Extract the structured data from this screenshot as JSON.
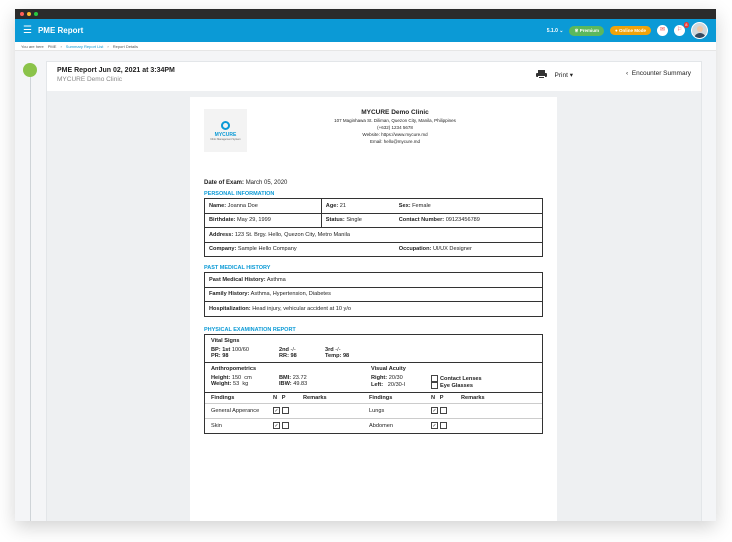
{
  "window": {
    "dots": [
      "#ff5f57",
      "#febc2e",
      "#28c840"
    ]
  },
  "appbar": {
    "title": "PME Report",
    "version": "5.1.0",
    "premium_label": "Premium",
    "online_label": "Online Mode",
    "notif_count_1": "",
    "notif_count_2": "8",
    "accent": "#0b9ad6",
    "premium_color": "#5cb85c",
    "online_color": "#f0a30a"
  },
  "breadcrumb": [
    "You are here",
    "PME",
    "Summary Report List",
    "Report Details"
  ],
  "report": {
    "title": "PME Report Jun 02, 2021 at 3:34PM",
    "clinic": "MYCURE Demo Clinic",
    "print_label": "Print",
    "encounter_label": "Encounter Summary"
  },
  "paper": {
    "logo_text": "MYCURE",
    "logo_tag": "Clinic Management System",
    "clinic_name": "MYCURE Demo Clinic",
    "address": "107 Maginhawa St. Diliman, Quezon City, Manila, Philippines",
    "phone": "(+632) 1234 5678",
    "website": "Website: https://www.mycure.md",
    "email": "Email: hello@mycure.md",
    "date_label": "Date of Exam:",
    "date_value": "March 05, 2020",
    "personal": {
      "title": "PERSONAL INFORMATION",
      "name_label": "Name:",
      "name": "Joanna Doe",
      "age_label": "Age:",
      "age": "21",
      "sex_label": "Sex:",
      "sex": "Female",
      "birth_label": "Birthdate:",
      "birth": "May 29, 1999",
      "status_label": "Status:",
      "status": "Single",
      "contact_label": "Contact Number:",
      "contact": "09123456789",
      "address_label": "Address:",
      "address": "123 St. Brgy. Hello, Quezon City, Metro Manila",
      "company_label": "Company:",
      "company": "Sample Hello Company",
      "occupation_label": "Occupation:",
      "occupation": "UI/UX Designer"
    },
    "history": {
      "title": "PAST MEDICAL HISTORY",
      "past_label": "Past Medical History:",
      "past": "Asthma",
      "family_label": "Family History:",
      "family": "Asthma, Hypertension, Diabetes",
      "hosp_label": "Hospitalization:",
      "hosp": "Head injury, vehicular accident at 10 y/o"
    },
    "physical": {
      "title": "PHYSICAL EXAMINATION REPORT",
      "vitals_label": "Vital Signs",
      "bp_label": "BP: 1st",
      "bp": "100/60",
      "second_label": "2nd",
      "second": "-/-",
      "third_label": "3rd",
      "third": "-/-",
      "pr_label": "PR:",
      "pr": "98",
      "rr_label": "RR:",
      "rr": "98",
      "temp_label": "Temp:",
      "temp": "98",
      "anthro_label": "Anthropometrics",
      "height_label": "Height:",
      "height": "150",
      "height_unit": "cm",
      "weight_label": "Weight:",
      "weight": "53",
      "weight_unit": "kg",
      "bmi_label": "BMI:",
      "bmi": "23.72",
      "ibw_label": "IBW:",
      "ibw": "49.83",
      "visual_label": "Visual Acuity",
      "right_label": "Right:",
      "right": "20/30",
      "left_label": "Left:",
      "left": "20/30-I",
      "contacts_label": "Contact Lenses",
      "glasses_label": "Eye Glasses",
      "findings_label": "Findings",
      "n_label": "N",
      "p_label": "P",
      "remarks_label": "Remarks",
      "rows": [
        {
          "left": "General Apperance",
          "right": "Lungs"
        },
        {
          "left": "Skin",
          "right": "Abdomen"
        }
      ]
    }
  }
}
